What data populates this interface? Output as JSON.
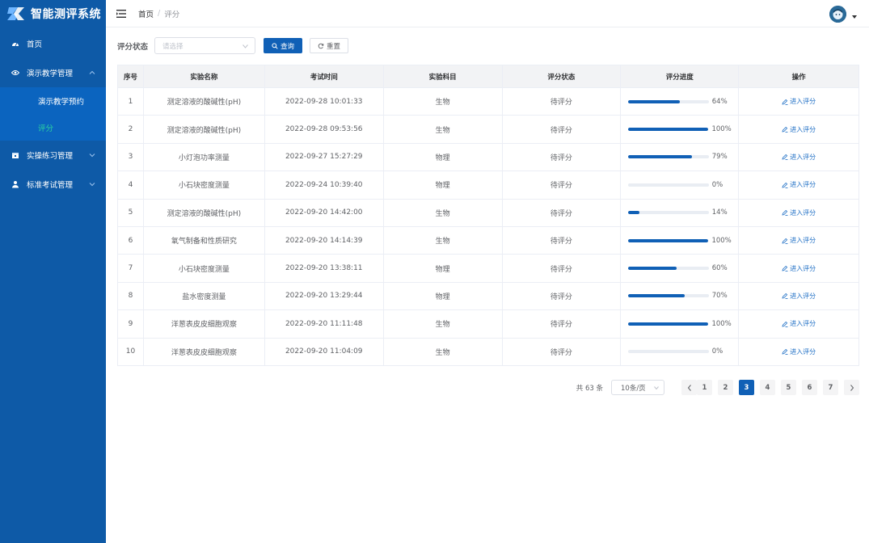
{
  "app": {
    "title": "智能测评系统"
  },
  "sidebar": {
    "items": [
      {
        "label": "首页",
        "icon": "dashboard-icon"
      },
      {
        "label": "演示教学管理",
        "icon": "eye-icon",
        "expanded": true,
        "children": [
          {
            "label": "演示教学预约",
            "active": false
          },
          {
            "label": "评分",
            "active": true
          }
        ]
      },
      {
        "label": "实操练习管理",
        "icon": "calendar-icon"
      },
      {
        "label": "标准考试管理",
        "icon": "user-icon"
      }
    ]
  },
  "header": {
    "breadcrumb": [
      "首页",
      "评分"
    ],
    "separator": "/"
  },
  "filter": {
    "label": "评分状态",
    "select_placeholder": "请选择",
    "query_label": "查询",
    "reset_label": "重置"
  },
  "table": {
    "columns": [
      "序号",
      "实验名称",
      "考试时间",
      "实验科目",
      "评分状态",
      "评分进度",
      "操作"
    ],
    "action_label": "进入评分",
    "rows": [
      {
        "no": "1",
        "name": "测定溶液的酸碱性(pH)",
        "time": "2022-09-28 10:01:33",
        "subject": "生物",
        "status": "待评分",
        "progress": 64,
        "progress_text": "64%"
      },
      {
        "no": "2",
        "name": "测定溶液的酸碱性(pH)",
        "time": "2022-09-28 09:53:56",
        "subject": "生物",
        "status": "待评分",
        "progress": 100,
        "progress_text": "100%"
      },
      {
        "no": "3",
        "name": "小灯泡功率测量",
        "time": "2022-09-27 15:27:29",
        "subject": "物理",
        "status": "待评分",
        "progress": 79,
        "progress_text": "79%"
      },
      {
        "no": "4",
        "name": "小石块密度测量",
        "time": "2022-09-24 10:39:40",
        "subject": "物理",
        "status": "待评分",
        "progress": 0,
        "progress_text": "0%"
      },
      {
        "no": "5",
        "name": "测定溶液的酸碱性(pH)",
        "time": "2022-09-20 14:42:00",
        "subject": "生物",
        "status": "待评分",
        "progress": 14,
        "progress_text": "14%"
      },
      {
        "no": "6",
        "name": "氧气制备和性质研究",
        "time": "2022-09-20 14:14:39",
        "subject": "生物",
        "status": "待评分",
        "progress": 100,
        "progress_text": "100%"
      },
      {
        "no": "7",
        "name": "小石块密度测量",
        "time": "2022-09-20 13:38:11",
        "subject": "物理",
        "status": "待评分",
        "progress": 60,
        "progress_text": "60%"
      },
      {
        "no": "8",
        "name": "盐水密度测量",
        "time": "2022-09-20 13:29:44",
        "subject": "物理",
        "status": "待评分",
        "progress": 70,
        "progress_text": "70%"
      },
      {
        "no": "9",
        "name": "洋葱表皮皮细胞观察",
        "time": "2022-09-20 11:11:48",
        "subject": "生物",
        "status": "待评分",
        "progress": 100,
        "progress_text": "100%"
      },
      {
        "no": "10",
        "name": "洋葱表皮皮细胞观察",
        "time": "2022-09-20 11:04:09",
        "subject": "生物",
        "status": "待评分",
        "progress": 0,
        "progress_text": "0%"
      }
    ]
  },
  "pagination": {
    "total_text": "共 63 条",
    "page_size": "10条/页",
    "pages": [
      "1",
      "2",
      "3",
      "4",
      "5",
      "6",
      "7"
    ],
    "current": "3"
  },
  "colors": {
    "sidebar_bg": "#0e5aa7",
    "submenu_bg": "#0b64bf",
    "submenu_active": "#2bd3a0",
    "primary": "#1060b6",
    "link": "#1f6fc5"
  }
}
